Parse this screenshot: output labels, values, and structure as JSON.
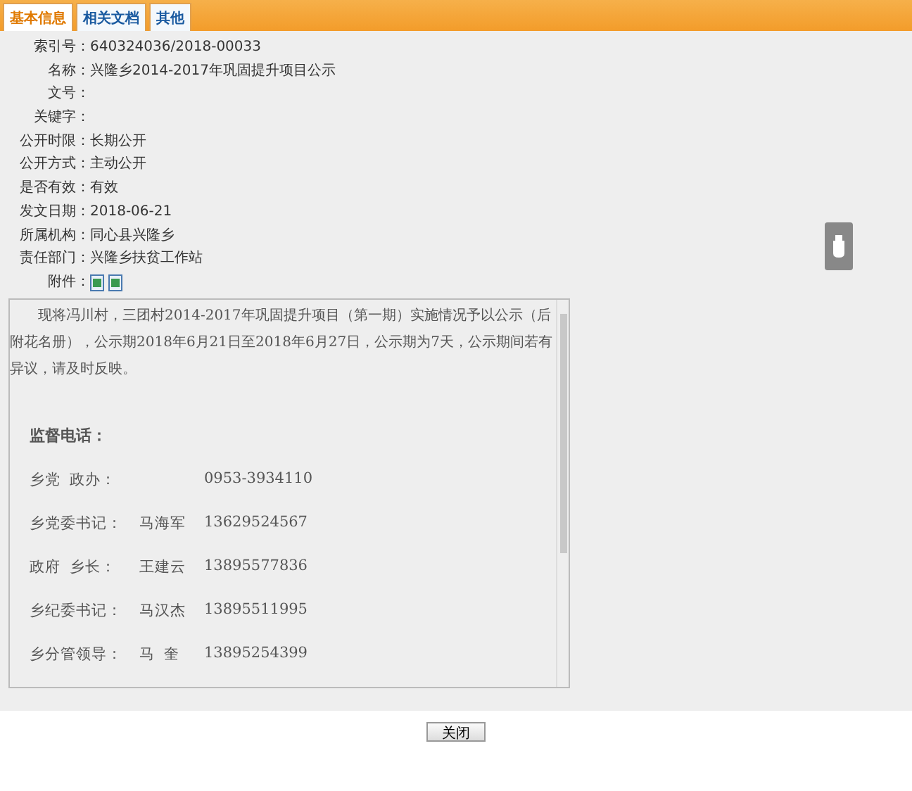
{
  "tabs": [
    {
      "label": "基本信息",
      "selected": true
    },
    {
      "label": "相关文档",
      "selected": false
    },
    {
      "label": "其他",
      "selected": false
    }
  ],
  "fields": [
    {
      "label": "索引号：",
      "value": "640324036/2018-00033"
    },
    {
      "label": "名称：",
      "value": "兴隆乡2014-2017年巩固提升项目公示"
    },
    {
      "label": "文号："
    },
    {
      "label": "关键字："
    },
    {
      "label": "公开时限：",
      "value": "长期公开"
    },
    {
      "label": "公开方式：",
      "value": "主动公开"
    },
    {
      "label": "是否有效：",
      "value": "有效"
    },
    {
      "label": "发文日期：",
      "value": "2018-06-21"
    },
    {
      "label": "所属机构：",
      "value": "同心县兴隆乡"
    },
    {
      "label": "责任部门：",
      "value": "兴隆乡扶贫工作站"
    }
  ],
  "attachments": {
    "label": "附件："
  },
  "content": {
    "intro": "现将冯川村，三团村2014-2017年巩固提升项目（第一期）实施情况予以公示（后附花名册），公示期2018年6月21日至2018年6月27日，公示期为7天，公示期间若有异议，请及时反映。",
    "heading": "监督电话：",
    "contacts": [
      {
        "role": "乡党  政办：",
        "phone": "0953-3934110"
      },
      {
        "role": "乡党委书记：",
        "name": "马海军",
        "phone": "13629524567"
      },
      {
        "role": "政府  乡长：",
        "name": "王建云",
        "phone": "13895577836"
      },
      {
        "role": "乡纪委书记：",
        "name": "马汉杰",
        "phone": "13895511995"
      },
      {
        "role": "乡分管领导：",
        "name": "马  奎",
        "phone": "13895254399"
      }
    ]
  },
  "close_button": "关闭"
}
